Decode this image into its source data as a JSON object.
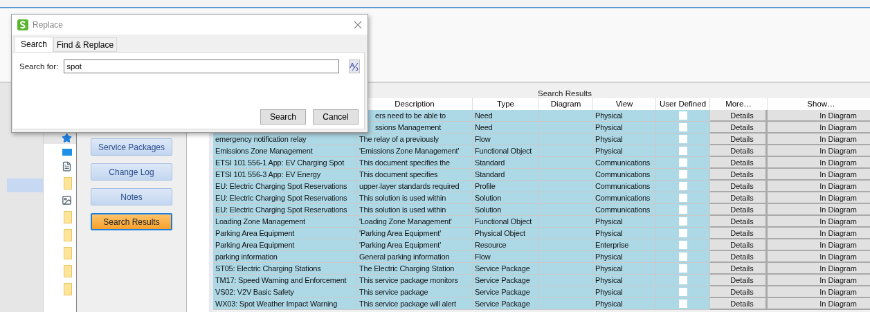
{
  "nav_buttons": [
    {
      "label": "Service Packages",
      "selected": false
    },
    {
      "label": "Change Log",
      "selected": false
    },
    {
      "label": "Notes",
      "selected": false
    },
    {
      "label": "Search Results",
      "selected": true
    }
  ],
  "results": {
    "title": "Search Results",
    "columns": [
      "Description",
      "Type",
      "Diagram",
      "View",
      "User Defined",
      "More…",
      "Show…"
    ],
    "rows": [
      {
        "description": "ers need to be able to",
        "type": "Need",
        "view": "Physical",
        "user_defined": false,
        "more": "Details",
        "show": "In Diagram"
      },
      {
        "description": "ssions Management",
        "type": "Need",
        "view": "Physical",
        "user_defined": false,
        "more": "Details",
        "show": "In Diagram"
      },
      {
        "name": "emergency notification relay",
        "description": "The relay of a previously",
        "type": "Flow",
        "view": "Physical",
        "user_defined": false,
        "more": "Details",
        "show": "In Diagram"
      },
      {
        "name": "Emissions Zone Management",
        "description": "'Emissions Zone Management'",
        "type": "Functional Object",
        "view": "Physical",
        "user_defined": false,
        "more": "Details",
        "show": "In Diagram"
      },
      {
        "name": "ETSI 101 556-1 App: EV Charging Spot",
        "description": "This document specifies the",
        "type": "Standard",
        "view": "Communications",
        "user_defined": false,
        "more": "Details",
        "show": "In Diagram"
      },
      {
        "name": "ETSI 101 556-3 App:  EV Energy",
        "description": "This document specifies",
        "type": "Standard",
        "view": "Communications",
        "user_defined": false,
        "more": "Details",
        "show": "In Diagram"
      },
      {
        "name": "EU: Electric Charging Spot Reservations",
        "description": "upper-layer standards required",
        "type": "Profile",
        "view": "Communications",
        "user_defined": false,
        "more": "Details",
        "show": "In Diagram"
      },
      {
        "name": "EU: Electric Charging Spot Reservations",
        "description": "This solution is used within",
        "type": "Solution",
        "view": "Communications",
        "user_defined": false,
        "more": "Details",
        "show": "In Diagram"
      },
      {
        "name": "EU: Electric Charging Spot Reservations",
        "description": "This solution is used within",
        "type": "Solution",
        "view": "Communications",
        "user_defined": false,
        "more": "Details",
        "show": "In Diagram"
      },
      {
        "name": "Loading Zone Management",
        "description": "'Loading Zone Management'",
        "type": "Functional Object",
        "view": "Physical",
        "user_defined": false,
        "more": "Details",
        "show": "In Diagram"
      },
      {
        "name": "Parking Area Equipment",
        "description": "'Parking Area Equipment'",
        "type": "Physical Object",
        "view": "Physical",
        "user_defined": false,
        "more": "Details",
        "show": "In Diagram"
      },
      {
        "name": "Parking Area Equipment",
        "description": "'Parking Area Equipment'",
        "type": "Resource",
        "view": "Enterprise",
        "user_defined": false,
        "more": "Details",
        "show": "In Diagram"
      },
      {
        "name": "parking information",
        "description": "General parking information",
        "type": "Flow",
        "view": "Physical",
        "user_defined": false,
        "more": "Details",
        "show": "In Diagram"
      },
      {
        "name": "ST05: Electric Charging Stations",
        "description": "The Electric Charging Station",
        "type": "Service Package",
        "view": "Physical",
        "user_defined": false,
        "more": "Details",
        "show": "In Diagram"
      },
      {
        "name": "TM17: Speed Warning and Enforcement",
        "description": "This service package monitors",
        "type": "Service Package",
        "view": "Physical",
        "user_defined": false,
        "more": "Details",
        "show": "In Diagram"
      },
      {
        "name": "VS02: V2V Basic Safety",
        "description": "This service package",
        "type": "Service Package",
        "view": "Physical",
        "user_defined": false,
        "more": "Details",
        "show": "In Diagram"
      },
      {
        "name": "WX03: Spot Weather Impact Warning",
        "description": "This service package will alert",
        "type": "Service Package",
        "view": "Physical",
        "user_defined": false,
        "more": "Details",
        "show": "In Diagram"
      }
    ]
  },
  "dialog": {
    "title": "Replace",
    "tabs": [
      {
        "label": "Search",
        "selected": true
      },
      {
        "label": "Find & Replace",
        "selected": false
      }
    ],
    "search_label": "Search for:",
    "search_value": "spot",
    "buttons": [
      "Search",
      "Cancel"
    ]
  }
}
